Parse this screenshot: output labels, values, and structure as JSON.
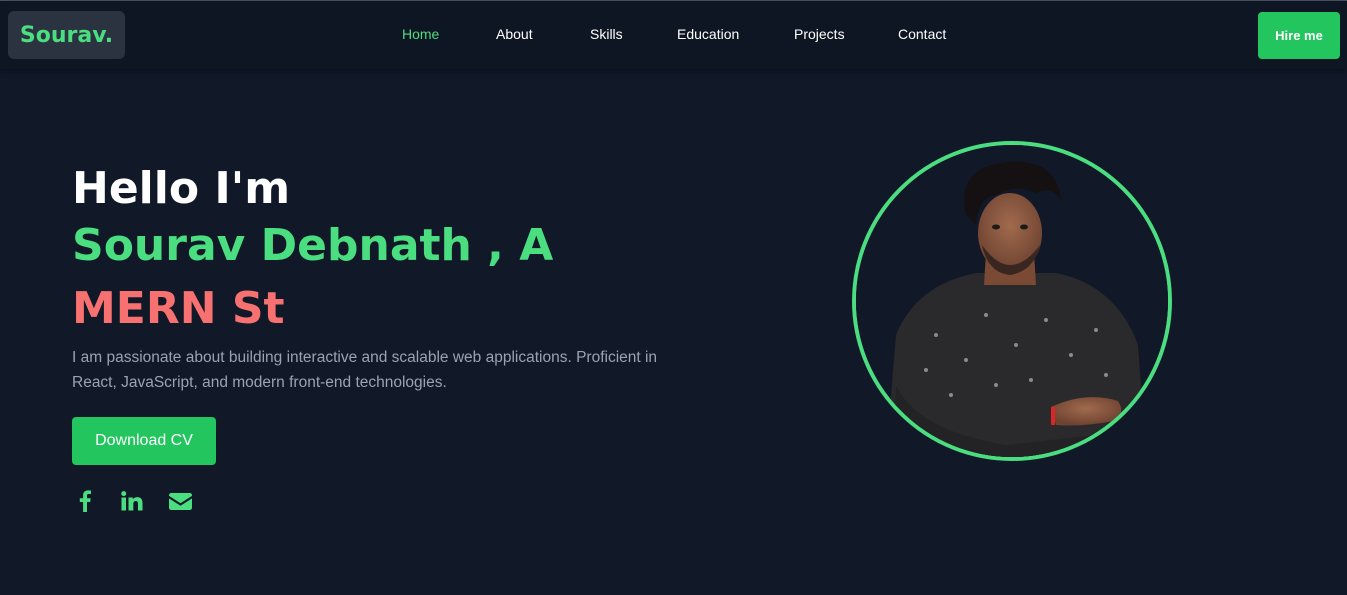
{
  "brand": {
    "logo_text": "Sourav."
  },
  "nav": {
    "items": [
      {
        "label": "Home",
        "active": true
      },
      {
        "label": "About"
      },
      {
        "label": "Skills"
      },
      {
        "label": "Education"
      },
      {
        "label": "Projects"
      },
      {
        "label": "Contact"
      }
    ],
    "cta_label": "Hire me"
  },
  "hero": {
    "greeting": "Hello I'm",
    "name_line": "Sourav Debnath , A",
    "role_line": "MERN St",
    "description": "I am passionate about building interactive and scalable web applications. Proficient in React, JavaScript, and modern front-end technologies.",
    "download_cv_label": "Download CV"
  },
  "social": [
    {
      "icon": "facebook-icon"
    },
    {
      "icon": "linkedin-icon"
    },
    {
      "icon": "envelope-icon"
    }
  ],
  "colors": {
    "background": "#111827",
    "accent_green": "#4ade80",
    "button_green": "#22c55e",
    "role_red": "#f87171",
    "muted_text": "#9ca3af"
  }
}
